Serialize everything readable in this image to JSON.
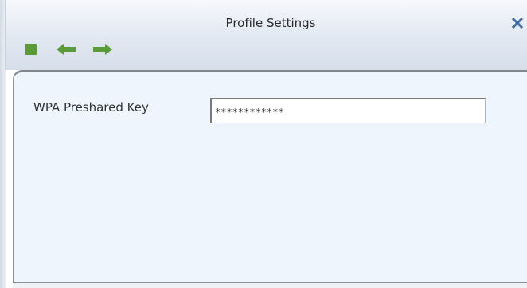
{
  "window": {
    "title": "Profile Settings",
    "close_glyph": "✕"
  },
  "toolbar": {
    "stop_icon": "square-stop-icon",
    "back_icon": "arrow-left-icon",
    "forward_icon": "arrow-right-icon",
    "accent_color": "#5a9a37"
  },
  "form": {
    "wpa_label": "WPA Preshared Key",
    "wpa_value": "************"
  }
}
